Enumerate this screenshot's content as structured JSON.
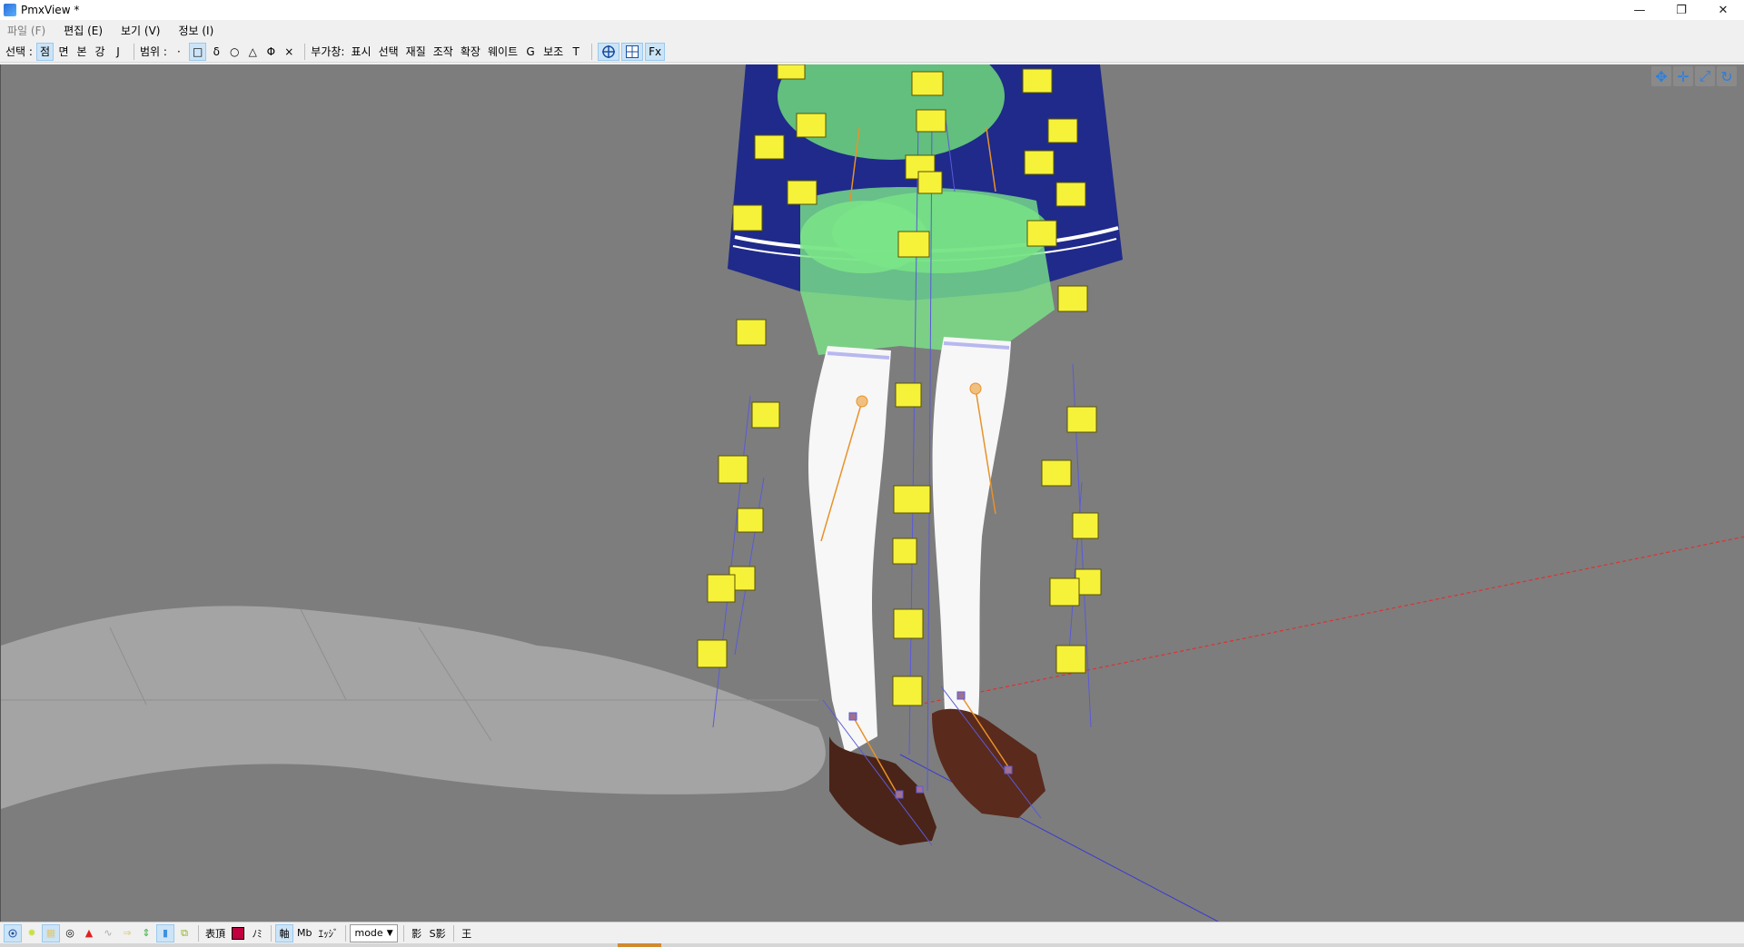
{
  "window": {
    "title": "PmxView *",
    "controls": {
      "minimize": "—",
      "restore": "❐",
      "close": "✕"
    }
  },
  "menu": [
    {
      "label": "파일 (F)",
      "enabled": false
    },
    {
      "label": "편집 (E)",
      "enabled": true
    },
    {
      "label": "보기 (V)",
      "enabled": true
    },
    {
      "label": "정보 (I)",
      "enabled": true
    }
  ],
  "toolbar": {
    "select_label": "선택 :",
    "select_items": [
      "점",
      "면",
      "본",
      "강",
      "J"
    ],
    "range_label": "범위 :",
    "range_items": [
      "·",
      "□",
      "δ",
      "○",
      "△",
      "Φ",
      "×"
    ],
    "addon_label": "부가창:",
    "addon_items": [
      "표시",
      "선택",
      "재질",
      "조작",
      "확장",
      "웨이트",
      "G",
      "보조",
      "T"
    ],
    "fx_label": "Fx"
  },
  "status": {
    "morph_label": "表頂",
    "script_label": "ﾉﾐ",
    "axis_label": "軸",
    "local_label": "Mb",
    "edge_label": "ｴｯｼﾞ",
    "mode_label": "mode",
    "shadow_label": "影",
    "sshadow_label": "S影",
    "last_label": "王"
  },
  "colors": {
    "viewport_bg": "#7d7d7d",
    "skirt": "#1f2a8a",
    "body_green": "#6fd97a",
    "stocking": "#f7f7f7",
    "shoe": "#4a2418",
    "rigid_body": "#f6f23a",
    "bone_line": "#5a5ad8",
    "bone_orange": "#e8922a",
    "axis_x": "#e03030"
  }
}
